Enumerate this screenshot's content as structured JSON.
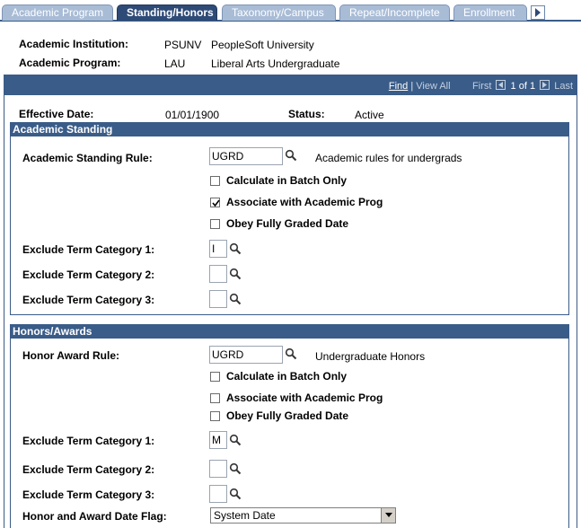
{
  "tabs": [
    {
      "label": "Academic Program",
      "active": false
    },
    {
      "label": "Standing/Honors",
      "active": true
    },
    {
      "label": "Taxonomy/Campus",
      "active": false
    },
    {
      "label": "Repeat/Incomplete",
      "active": false
    },
    {
      "label": "Enrollment",
      "active": false
    }
  ],
  "header": {
    "institution_label": "Academic Institution:",
    "institution_code": "PSUNV",
    "institution_name": "PeopleSoft University",
    "program_label": "Academic Program:",
    "program_code": "LAU",
    "program_name": "Liberal Arts Undergraduate"
  },
  "grid_nav": {
    "find": "Find",
    "separator": "|",
    "view_all": "View All",
    "first": "First",
    "count": "1 of 1",
    "last": "Last"
  },
  "effective": {
    "date_label": "Effective Date:",
    "date_value": "01/01/1900",
    "status_label": "Status:",
    "status_value": "Active"
  },
  "academic_standing": {
    "title": "Academic Standing",
    "rule_label": "Academic Standing Rule:",
    "rule_value": "UGRD",
    "rule_desc": "Academic rules for undergrads",
    "checkboxes": [
      {
        "label": "Calculate in Batch Only",
        "checked": false
      },
      {
        "label": "Associate with Academic Prog",
        "checked": true
      },
      {
        "label": "Obey Fully Graded Date",
        "checked": false
      }
    ],
    "exclude": [
      {
        "label": "Exclude Term Category 1:",
        "value": "I"
      },
      {
        "label": "Exclude Term Category 2:",
        "value": ""
      },
      {
        "label": "Exclude Term Category 3:",
        "value": ""
      }
    ]
  },
  "honors_awards": {
    "title": "Honors/Awards",
    "rule_label": "Honor Award Rule:",
    "rule_value": "UGRD",
    "rule_desc": "Undergraduate Honors",
    "checkboxes": [
      {
        "label": "Calculate in Batch Only",
        "checked": false
      },
      {
        "label": "Associate with Academic Prog",
        "checked": false
      },
      {
        "label": "Obey Fully Graded Date",
        "checked": false
      }
    ],
    "exclude": [
      {
        "label": "Exclude Term Category 1:",
        "value": "M"
      },
      {
        "label": "Exclude Term Category 2:",
        "value": ""
      },
      {
        "label": "Exclude Term Category 3:",
        "value": ""
      }
    ],
    "date_flag_label": "Honor and Award Date Flag:",
    "date_flag_value": "System Date"
  },
  "icons": {
    "lookup": "magnifier-icon",
    "next_tab": "tab-scroll-right-icon",
    "dropdown": "dropdown-arrow-icon"
  },
  "colors": {
    "header_blue": "#3a5c88",
    "tab_inactive": "#a9bcd6",
    "tab_active": "#2e4a76"
  }
}
